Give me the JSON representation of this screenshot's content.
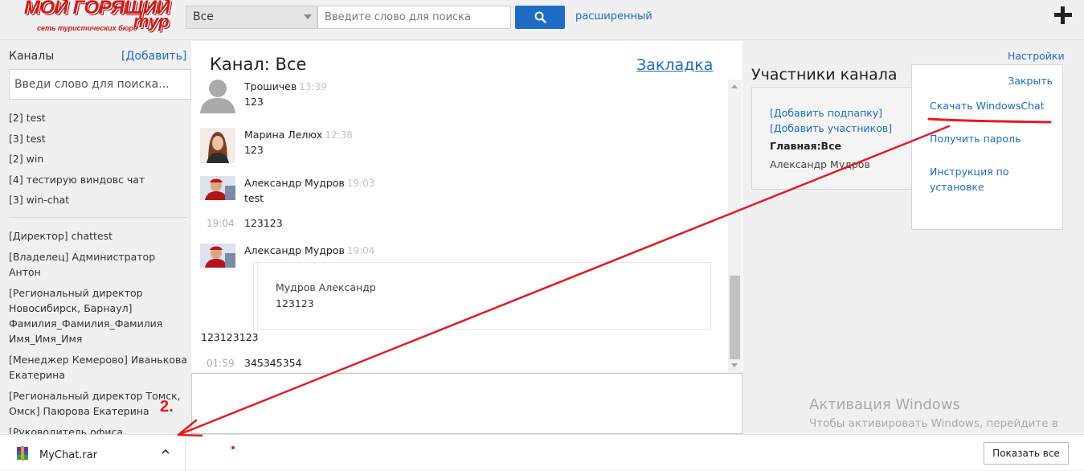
{
  "brand": {
    "logo_main": "МОЙ ГОРЯЩИЙ",
    "logo_tail": "тур",
    "logo_sub": "сеть туристических бюро"
  },
  "search": {
    "scope": "Все",
    "placeholder": "Введите слово для поиска",
    "advanced_link": "расширенный"
  },
  "sidebar": {
    "title": "Каналы",
    "add_link": "[Добавить]",
    "search_placeholder": "Введи слово для поиска...",
    "channels": [
      "[2] test",
      "[3] test",
      "[2] win",
      "[4] тестирую виндовс чат",
      "[3] win-chat"
    ],
    "contacts": [
      "[Директор] chattest",
      "[Владелец] Администратор Антон",
      "[Региональный директор Новосибирск, Барнаул] Фамилия_Фамилия_Фамилия Имя_Имя_Имя",
      "[Менеджер Кемерово] Иванькова Екатерина",
      "[Региональный директор Томск, Омск] Паюрова Екатерина",
      "[Руководитель офиса Калининград] Хрол Светлана"
    ]
  },
  "chat": {
    "title": "Канал: Все",
    "bookmark": "Закладка",
    "messages": [
      {
        "author": "Трошичев",
        "time": "13:39",
        "text": "123"
      },
      {
        "author": "Марина Лелюх",
        "time": "12:38",
        "text": "123"
      },
      {
        "author": "Александр Мудров",
        "time": "19:03",
        "text": "test"
      },
      {
        "time": "19:04",
        "text": "123123"
      },
      {
        "author": "Александр Мудров",
        "time": "19:04"
      },
      {
        "text": "123123123"
      },
      {
        "time": "01:59",
        "text": "345345354"
      }
    ],
    "quote": {
      "author": "Мудров Александр",
      "text": "123123"
    }
  },
  "members": {
    "title": "Участники канала",
    "add_folder": "[Добавить подпапку]",
    "add_members": "[Добавить участников]",
    "main_all": "Главная:Все",
    "member": "Александр Мудров"
  },
  "menu": {
    "settings": "Настройки",
    "close": "Закрыть",
    "download": "Скачать WindowsChat",
    "get_password": "Получить пароль",
    "install_guide": "Инструкция по установке"
  },
  "watermark": {
    "title": "Активация Windows",
    "text": "Чтобы активировать Windows, перейдите в раздел \"Параметры\"."
  },
  "download_bar": {
    "file": "MyChat.rar",
    "show_all": "Показать все"
  },
  "annotation": {
    "label": "2.",
    "color": "#e41b23"
  },
  "colors": {
    "link": "#1e6bc6",
    "brand_red": "#d11a1a",
    "search_button": "#1e6bc6"
  }
}
